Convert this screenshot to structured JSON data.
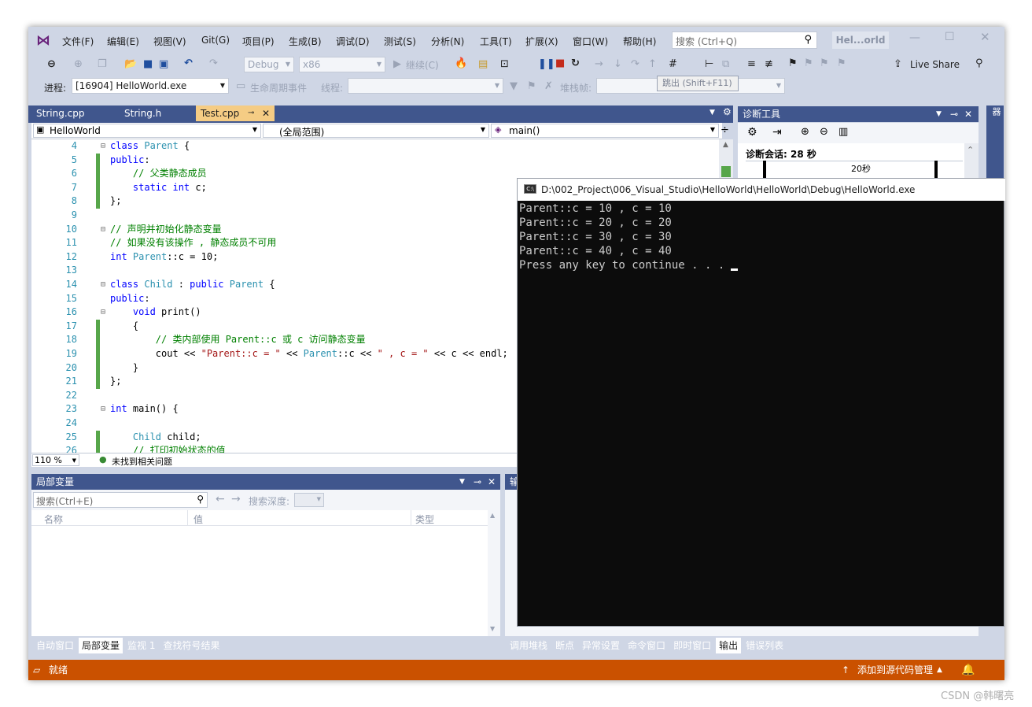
{
  "menu": {
    "items": [
      "文件(F)",
      "编辑(E)",
      "视图(V)",
      "Git(G)",
      "项目(P)",
      "生成(B)",
      "调试(D)",
      "测试(S)",
      "分析(N)",
      "工具(T)",
      "扩展(X)",
      "窗口(W)",
      "帮助(H)"
    ],
    "search_placeholder": "搜索 (Ctrl+Q)",
    "solution_name": "Hel...orld"
  },
  "toolbar": {
    "config": "Debug",
    "platform": "x86",
    "continue_label": "继续(C)",
    "live_share": "Live Share",
    "process_label": "进程:",
    "process_value": "[16904] HelloWorld.exe",
    "lifecycle_label": "生命周期事件",
    "thread_label": "线程:",
    "stackframe_label": "堆栈帧:",
    "tooltip": "跳出 (Shift+F11)"
  },
  "tabs": [
    {
      "label": "String.cpp"
    },
    {
      "label": "String.h"
    },
    {
      "label": "Test.cpp"
    }
  ],
  "nav": {
    "project": "HelloWorld",
    "scope": "(全局范围)",
    "member": "main()"
  },
  "code_lines": [
    {
      "n": "4",
      "parts": [
        [
          "kw",
          "class "
        ],
        [
          "typ",
          "Parent"
        ],
        [
          "txt",
          " {"
        ]
      ]
    },
    {
      "n": "5",
      "parts": [
        [
          "kw",
          "public"
        ],
        [
          "txt",
          ":"
        ]
      ]
    },
    {
      "n": "6",
      "parts": [
        [
          "cmt",
          "    // 父类静态成员"
        ]
      ]
    },
    {
      "n": "7",
      "parts": [
        [
          "kw",
          "    static int "
        ],
        [
          "txt",
          "c;"
        ]
      ]
    },
    {
      "n": "8",
      "parts": [
        [
          "txt",
          "};"
        ]
      ]
    },
    {
      "n": "9",
      "parts": []
    },
    {
      "n": "10",
      "parts": [
        [
          "cmt",
          "// 声明并初始化静态变量"
        ]
      ]
    },
    {
      "n": "11",
      "parts": [
        [
          "cmt",
          "// 如果没有该操作 , 静态成员不可用"
        ]
      ]
    },
    {
      "n": "12",
      "parts": [
        [
          "kw",
          "int "
        ],
        [
          "typ",
          "Parent"
        ],
        [
          "txt",
          "::c = 10;"
        ]
      ]
    },
    {
      "n": "13",
      "parts": []
    },
    {
      "n": "14",
      "parts": [
        [
          "kw",
          "class "
        ],
        [
          "typ",
          "Child"
        ],
        [
          "txt",
          " : "
        ],
        [
          "kw",
          "public "
        ],
        [
          "typ",
          "Parent"
        ],
        [
          "txt",
          " {"
        ]
      ]
    },
    {
      "n": "15",
      "parts": [
        [
          "kw",
          "public"
        ],
        [
          "txt",
          ":"
        ]
      ]
    },
    {
      "n": "16",
      "parts": [
        [
          "kw",
          "    void "
        ],
        [
          "txt",
          "print()"
        ]
      ]
    },
    {
      "n": "17",
      "parts": [
        [
          "txt",
          "    {"
        ]
      ]
    },
    {
      "n": "18",
      "parts": [
        [
          "cmt",
          "        // 类内部使用 Parent::c 或 c 访问静态变量"
        ]
      ]
    },
    {
      "n": "19",
      "parts": [
        [
          "txt",
          "        cout << "
        ],
        [
          "str",
          "\"Parent::c = \""
        ],
        [
          "txt",
          " << "
        ],
        [
          "typ",
          "Parent"
        ],
        [
          "txt",
          "::c << "
        ],
        [
          "str",
          "\" , c = \""
        ],
        [
          "txt",
          " << c << endl;"
        ]
      ]
    },
    {
      "n": "20",
      "parts": [
        [
          "txt",
          "    }"
        ]
      ]
    },
    {
      "n": "21",
      "parts": [
        [
          "txt",
          "};"
        ]
      ]
    },
    {
      "n": "22",
      "parts": []
    },
    {
      "n": "23",
      "parts": [
        [
          "kw",
          "int "
        ],
        [
          "txt",
          "main() {"
        ]
      ]
    },
    {
      "n": "24",
      "parts": []
    },
    {
      "n": "25",
      "parts": [
        [
          "typ",
          "    Child "
        ],
        [
          "txt",
          "child;"
        ]
      ]
    },
    {
      "n": "26",
      "parts": [
        [
          "cmt",
          "    // 打印初始状态的值"
        ]
      ]
    }
  ],
  "editor_status": {
    "zoom": "110 %",
    "issues": "未找到相关问题"
  },
  "diag": {
    "title": "诊断工具",
    "session": "诊断会话: 28 秒",
    "time_mark": "20秒"
  },
  "side_strip": "解决方案资源管理器",
  "console": {
    "title": "D:\\002_Project\\006_Visual_Studio\\HelloWorld\\HelloWorld\\Debug\\HelloWorld.exe",
    "lines": [
      "Parent::c = 10 , c = 10",
      "Parent::c = 20 , c = 20",
      "Parent::c = 30 , c = 30",
      "Parent::c = 40 , c = 40",
      "Press any key to continue . . ."
    ]
  },
  "locals": {
    "title": "局部变量",
    "search_placeholder": "搜索(Ctrl+E)",
    "depth_label": "搜索深度:",
    "col_name": "名称",
    "col_value": "值",
    "col_type": "类型"
  },
  "bottom_tabs_left": [
    "自动窗口",
    "局部变量",
    "监视 1",
    "查找符号结果"
  ],
  "bottom_tabs_right": [
    "调用堆栈",
    "断点",
    "异常设置",
    "命令窗口",
    "即时窗口",
    "输出",
    "错误列表"
  ],
  "output_title": "输",
  "status": {
    "ready": "就绪",
    "source_control": "添加到源代码管理"
  },
  "watermark": "CSDN @韩曙亮",
  "colors": {
    "chrome": "#cfd6e5",
    "panel_header": "#40568d",
    "accent_tab": "#f5cc84",
    "status_bar": "#ca5100",
    "console_bg": "#0c0c0c"
  }
}
